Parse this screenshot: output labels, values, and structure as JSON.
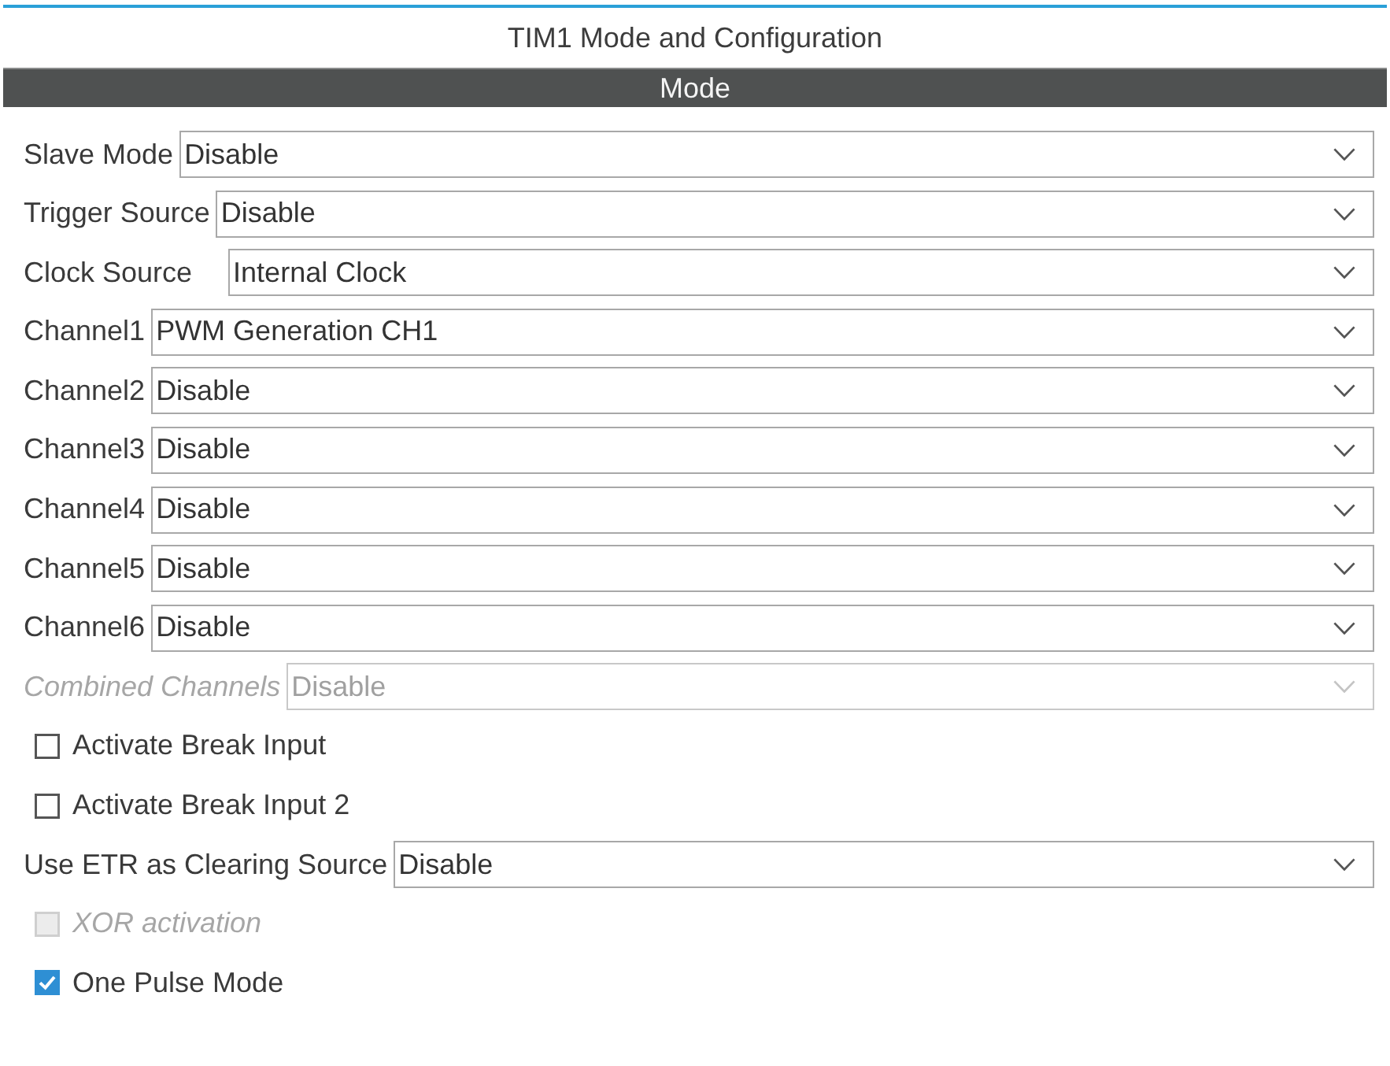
{
  "window": {
    "title": "TIM1 Mode and Configuration"
  },
  "section": {
    "title": "Mode"
  },
  "fields": [
    {
      "kind": "select",
      "label": "Slave Mode",
      "value": "Disable",
      "disabled": false
    },
    {
      "kind": "select",
      "label": "Trigger Source",
      "value": "Disable",
      "disabled": false
    },
    {
      "kind": "select",
      "label": "Clock Source",
      "value": "Internal Clock",
      "disabled": false
    },
    {
      "kind": "select",
      "label": "Channel1",
      "value": "PWM Generation CH1",
      "disabled": false
    },
    {
      "kind": "select",
      "label": "Channel2",
      "value": "Disable",
      "disabled": false
    },
    {
      "kind": "select",
      "label": "Channel3",
      "value": "Disable",
      "disabled": false
    },
    {
      "kind": "select",
      "label": "Channel4",
      "value": "Disable",
      "disabled": false
    },
    {
      "kind": "select",
      "label": "Channel5",
      "value": "Disable",
      "disabled": false
    },
    {
      "kind": "select",
      "label": "Channel6",
      "value": "Disable",
      "disabled": false
    },
    {
      "kind": "select",
      "label": "Combined Channels",
      "value": "Disable",
      "disabled": true
    },
    {
      "kind": "checkbox",
      "label": "Activate Break Input",
      "checked": false,
      "disabled": false
    },
    {
      "kind": "checkbox",
      "label": "Activate Break Input 2",
      "checked": false,
      "disabled": false
    },
    {
      "kind": "select",
      "label": "Use ETR as Clearing Source",
      "value": "Disable",
      "disabled": false
    },
    {
      "kind": "checkbox",
      "label": "XOR activation",
      "checked": false,
      "disabled": true
    },
    {
      "kind": "checkbox",
      "label": "One Pulse Mode",
      "checked": true,
      "disabled": false
    }
  ]
}
